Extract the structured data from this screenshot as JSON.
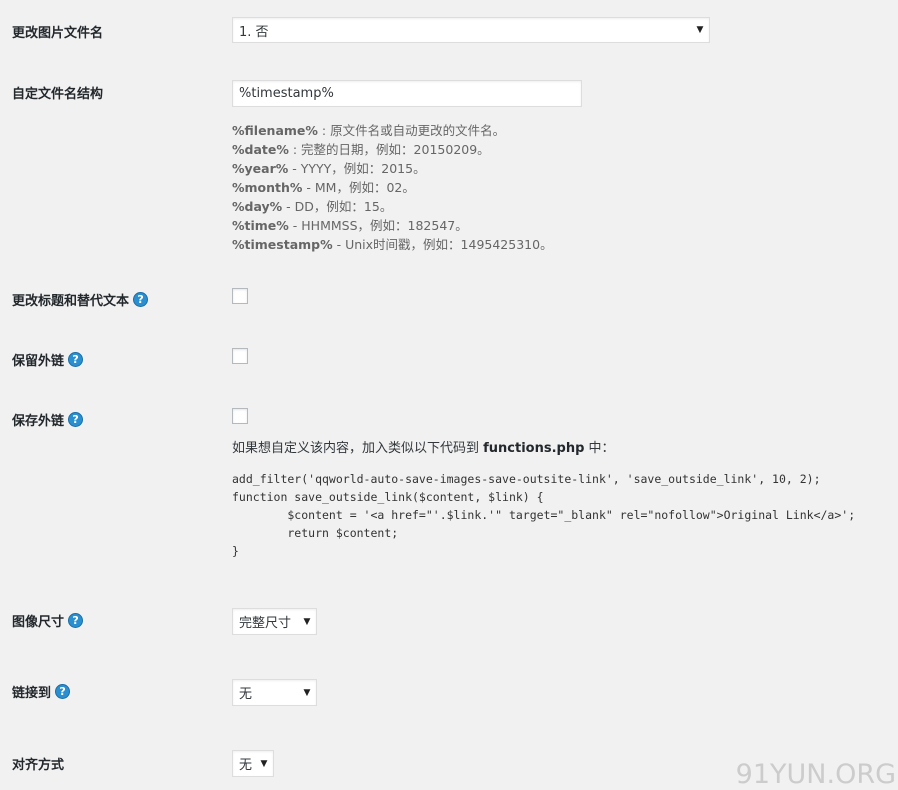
{
  "rename_file": {
    "label": "更改图片文件名",
    "selected": "1. 否"
  },
  "filename_structure": {
    "label": "自定文件名结构",
    "value": "%timestamp%",
    "description": [
      {
        "key": "%filename%",
        "text": " : 原文件名或自动更改的文件名。"
      },
      {
        "key": "%date%",
        "text": " : 完整的日期，例如：20150209。"
      },
      {
        "key": "%year%",
        "text": " - YYYY，例如：2015。"
      },
      {
        "key": "%month%",
        "text": " - MM，例如：02。"
      },
      {
        "key": "%day%",
        "text": " - DD，例如：15。"
      },
      {
        "key": "%time%",
        "text": " - HHMMSS，例如：182547。"
      },
      {
        "key": "%timestamp%",
        "text": " - Unix时间戳，例如：1495425310。"
      }
    ]
  },
  "change_title_alt": {
    "label": "更改标题和替代文本",
    "help": "?"
  },
  "keep_outside_link": {
    "label": "保留外链",
    "help": "?"
  },
  "save_outside_link": {
    "label": "保存外链",
    "help": "?",
    "note_prefix": "如果想自定义该内容，加入类似以下代码到 ",
    "note_file": "functions.php",
    "note_suffix": " 中：",
    "code": "add_filter('qqworld-auto-save-images-save-outsite-link', 'save_outside_link', 10, 2);\nfunction save_outside_link($content, $link) {\n        $content = '<a href=\"'.$link.'\" target=\"_blank\" rel=\"nofollow\">Original Link</a>';\n        return $content;\n}"
  },
  "image_size": {
    "label": "图像尺寸",
    "help": "?",
    "selected": "完整尺寸"
  },
  "link_to": {
    "label": "链接到",
    "help": "?",
    "selected": "无"
  },
  "alignment": {
    "label": "对齐方式",
    "selected": "无"
  },
  "watermark": "91YUN.ORG",
  "colors": {
    "help_icon": "#2a8fd0",
    "background": "#f1f1f1"
  }
}
